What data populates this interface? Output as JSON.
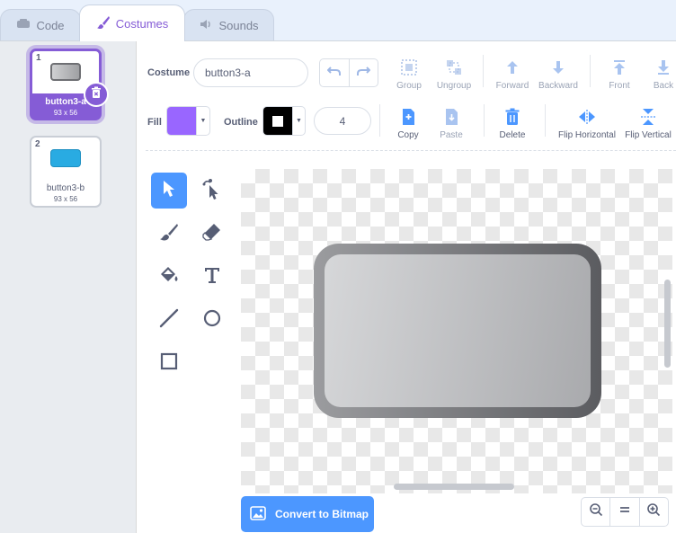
{
  "tabs": [
    {
      "label": "Code",
      "icon": "code-icon"
    },
    {
      "label": "Costumes",
      "icon": "brush-icon"
    },
    {
      "label": "Sounds",
      "icon": "speaker-icon"
    }
  ],
  "costumes": [
    {
      "number": "1",
      "name": "button3-a",
      "dims": "93 x 56",
      "selected": true
    },
    {
      "number": "2",
      "name": "button3-b",
      "dims": "93 x 56",
      "selected": false
    }
  ],
  "editor": {
    "costume_label": "Costume",
    "costume_name": "button3-a",
    "fill_label": "Fill",
    "fill_color": "#9966ff",
    "outline_label": "Outline",
    "outline_color": "#000000",
    "outline_width": "4",
    "toolbar": {
      "group": "Group",
      "ungroup": "Ungroup",
      "forward": "Forward",
      "backward": "Backward",
      "front": "Front",
      "back": "Back",
      "copy": "Copy",
      "paste": "Paste",
      "delete": "Delete",
      "flip_horizontal": "Flip Horizontal",
      "flip_vertical": "Flip Vertical"
    },
    "tools": [
      "select-tool",
      "reshape-tool",
      "brush-tool",
      "eraser-tool",
      "fill-tool",
      "text-tool",
      "line-tool",
      "circle-tool",
      "rectangle-tool"
    ],
    "convert_button": "Convert to Bitmap",
    "zoom": {
      "out": "zoom-out-icon",
      "reset": "zoom-reset-icon",
      "in": "zoom-in-icon"
    }
  },
  "colors": {
    "accent": "#855cd6",
    "primary": "#4c97ff",
    "danger": "#ff6680"
  }
}
